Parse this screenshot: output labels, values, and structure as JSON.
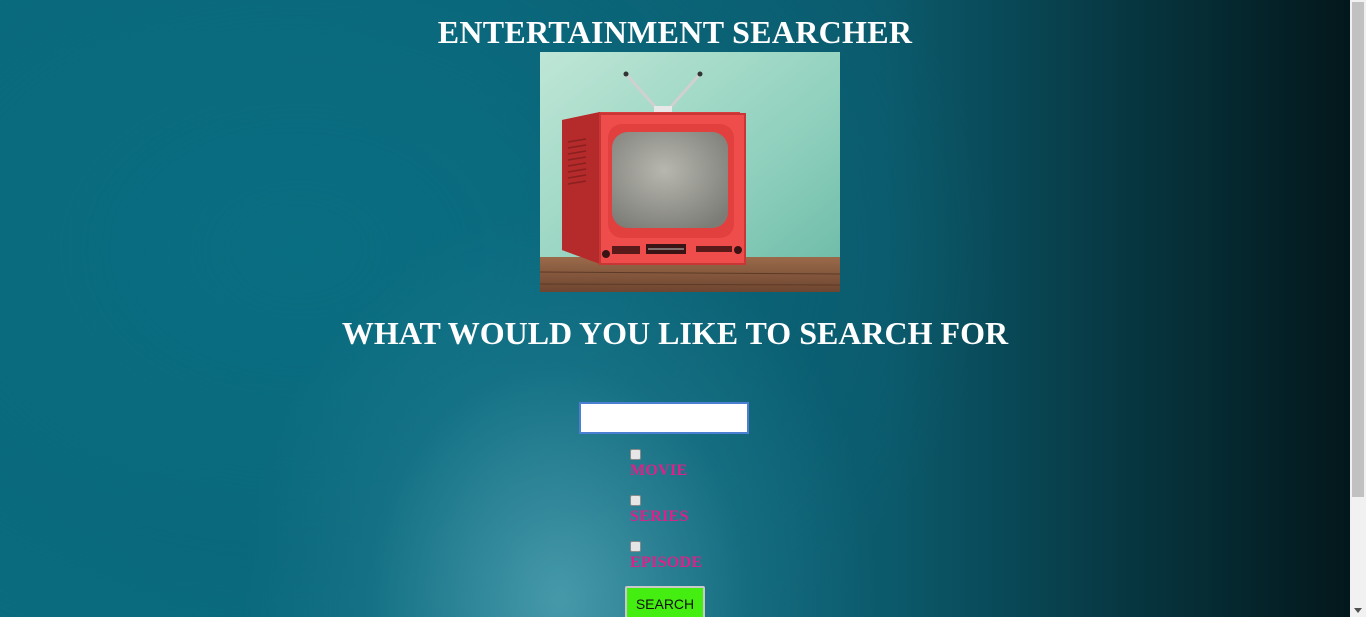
{
  "header": {
    "title": "ENTERTAINMENT SEARCHER"
  },
  "hero": {
    "image": "retro-red-tv-image"
  },
  "search": {
    "prompt": "WHAT WOULD YOU LIKE TO SEARCH FOR",
    "input_value": "",
    "options": [
      {
        "label": "MOVIE",
        "checked": false
      },
      {
        "label": "SERIES",
        "checked": false
      },
      {
        "label": "EPISODE",
        "checked": false
      }
    ],
    "button_label": "SEARCH"
  },
  "colors": {
    "option_label": "#e0208a",
    "button_bg": "#44ee11"
  }
}
